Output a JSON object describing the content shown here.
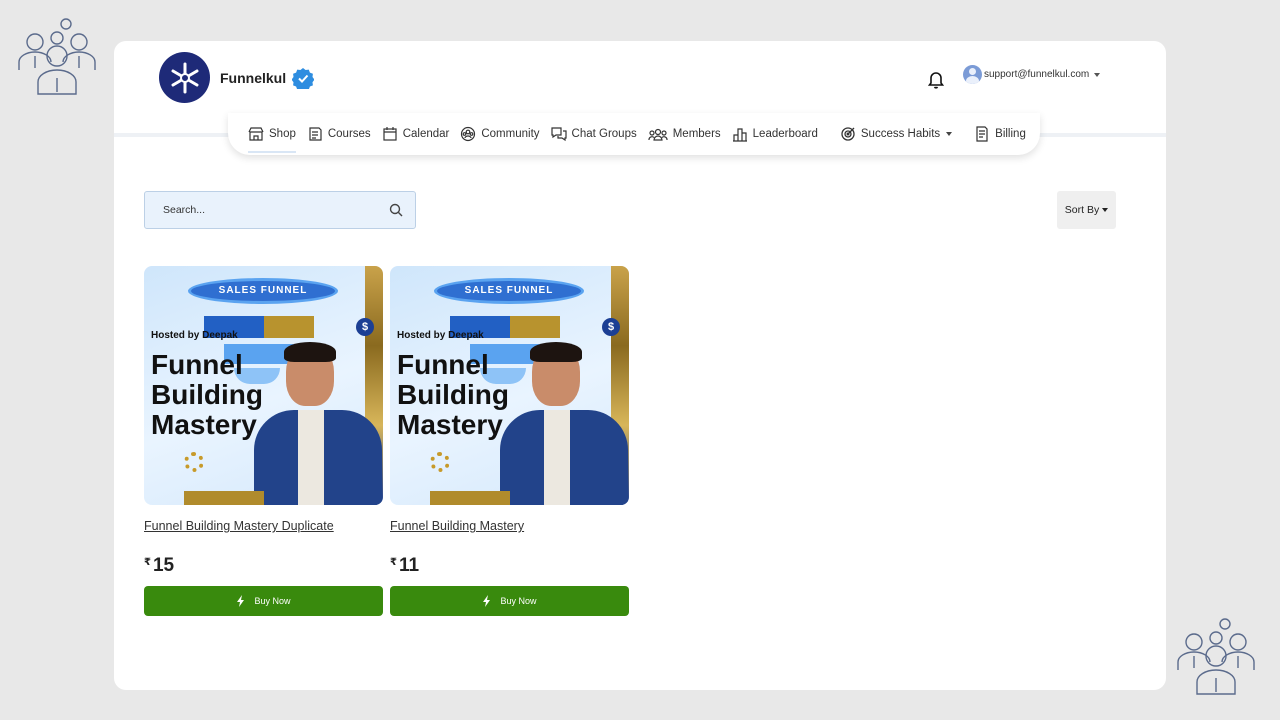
{
  "brand": {
    "name": "Funnelkul"
  },
  "user": {
    "email": "support@funnelkul.com"
  },
  "nav": [
    {
      "label": "Shop",
      "icon": "shop-icon"
    },
    {
      "label": "Courses",
      "icon": "courses-icon"
    },
    {
      "label": "Calendar",
      "icon": "calendar-icon"
    },
    {
      "label": "Community",
      "icon": "community-icon"
    },
    {
      "label": "Chat Groups",
      "icon": "chat-groups-icon"
    },
    {
      "label": "Members",
      "icon": "members-icon"
    },
    {
      "label": "Leaderboard",
      "icon": "leaderboard-icon"
    },
    {
      "label": "Success Habits",
      "icon": "target-icon"
    },
    {
      "label": "Billing",
      "icon": "billing-icon"
    }
  ],
  "search": {
    "placeholder": "Search..."
  },
  "sort": {
    "label": "Sort By"
  },
  "thumbnail": {
    "banner": "SALES FUNNEL",
    "hosted": "Hosted by Deepak",
    "title_line1": "Funnel",
    "title_line2": "Building",
    "title_line3": "Mastery",
    "dollar": "$"
  },
  "products": [
    {
      "name": "Funnel Building Mastery Duplicate",
      "currency": "₹",
      "price": "15",
      "button": "Buy Now"
    },
    {
      "name": "Funnel Building Mastery",
      "currency": "₹",
      "price": "11",
      "button": "Buy Now"
    }
  ],
  "colors": {
    "buy_button": "#398a0d",
    "brand_logo": "#1e2a78",
    "verified": "#2e8de0"
  }
}
